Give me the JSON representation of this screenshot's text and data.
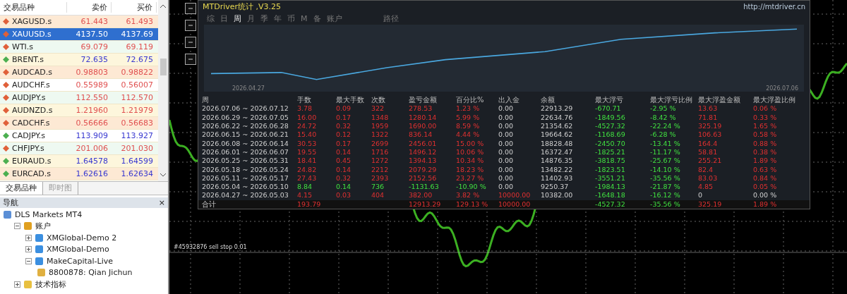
{
  "market_watch": {
    "columns": [
      "交易品种",
      "卖价",
      "买价"
    ],
    "rows": [
      {
        "symbol": "XAGUSD.s",
        "bid": "61.443",
        "ask": "61.493",
        "rising": false,
        "selected": false
      },
      {
        "symbol": "XAUUSD.s",
        "bid": "4137.50",
        "ask": "4137.69",
        "rising": false,
        "selected": true
      },
      {
        "symbol": "WTI.s",
        "bid": "69.079",
        "ask": "69.119",
        "rising": false,
        "selected": false
      },
      {
        "symbol": "BRENT.s",
        "bid": "72.635",
        "ask": "72.675",
        "rising": true,
        "selected": false
      },
      {
        "symbol": "AUDCAD.s",
        "bid": "0.98803",
        "ask": "0.98822",
        "rising": false,
        "selected": false
      },
      {
        "symbol": "AUDCHF.s",
        "bid": "0.55989",
        "ask": "0.56007",
        "rising": false,
        "selected": false
      },
      {
        "symbol": "AUDJPY.s",
        "bid": "112.550",
        "ask": "112.570",
        "rising": false,
        "selected": false
      },
      {
        "symbol": "AUDNZD.s",
        "bid": "1.21960",
        "ask": "1.21979",
        "rising": false,
        "selected": false
      },
      {
        "symbol": "CADCHF.s",
        "bid": "0.56666",
        "ask": "0.56683",
        "rising": false,
        "selected": false
      },
      {
        "symbol": "CADJPY.s",
        "bid": "113.909",
        "ask": "113.927",
        "rising": true,
        "selected": false
      },
      {
        "symbol": "CHFJPY.s",
        "bid": "201.006",
        "ask": "201.030",
        "rising": false,
        "selected": false
      },
      {
        "symbol": "EURAUD.s",
        "bid": "1.64578",
        "ask": "1.64599",
        "rising": true,
        "selected": false
      },
      {
        "symbol": "EURCAD.s",
        "bid": "1.62616",
        "ask": "1.62634",
        "rising": true,
        "selected": false
      }
    ],
    "tabs": [
      {
        "label": "交易品种",
        "selected": true
      },
      {
        "label": "即时图",
        "selected": false
      }
    ]
  },
  "navigator": {
    "title": "导航",
    "close": "×",
    "tree": [
      {
        "label": "DLS Markets MT4",
        "kind": "terminal",
        "children": [
          {
            "label": "账户",
            "kind": "accounts",
            "expanded": true,
            "children": [
              {
                "label": "XMGlobal-Demo 2",
                "kind": "server",
                "expanded": false
              },
              {
                "label": "XMGlobal-Demo",
                "kind": "server",
                "expanded": false
              },
              {
                "label": "MakeCapital-Live",
                "kind": "server",
                "expanded": true,
                "children": [
                  {
                    "label": "8800878: Qian Jichun",
                    "kind": "account"
                  }
                ]
              }
            ]
          },
          {
            "label": "技术指标",
            "kind": "indicators",
            "expanded": false
          }
        ]
      }
    ]
  },
  "chart": {
    "order_label": "#45932876 sell stop 0.01"
  },
  "stats_panel": {
    "title": "MTDriver统计 ,V3.25",
    "link": "http://mtdriver.cn",
    "tabs": [
      {
        "label": "综",
        "selected": false
      },
      {
        "label": "日",
        "selected": false
      },
      {
        "label": "周",
        "selected": true
      },
      {
        "label": "月",
        "selected": false
      },
      {
        "label": "季",
        "selected": false
      },
      {
        "label": "年",
        "selected": false
      },
      {
        "label": "币",
        "selected": false
      },
      {
        "label": "M",
        "selected": false
      },
      {
        "label": "备",
        "selected": false
      },
      {
        "label": "账户",
        "selected": false
      },
      {
        "label": "路径",
        "selected": false
      }
    ],
    "equity_dates": [
      "2026.04.27",
      "2026.07.06"
    ],
    "columns": [
      "周",
      "手数",
      "最大手数",
      "次数",
      "盈亏金额",
      "百分比%",
      "出入金",
      "余额",
      "最大浮亏",
      "最大浮亏比例",
      "最大浮盈金额",
      "最大浮盈比例"
    ],
    "rows": [
      {
        "loss": false,
        "deposit": false,
        "float_profit": true,
        "cells": [
          "2026.07.06 ~ 2026.07.12",
          "3.78",
          "0.09",
          "322",
          "278.53",
          "1.23 %",
          "0.00",
          "22913.29",
          "-670.71",
          "-2.95 %",
          "13.63",
          "0.06 %"
        ]
      },
      {
        "loss": false,
        "deposit": false,
        "float_profit": true,
        "cells": [
          "2026.06.29 ~ 2026.07.05",
          "16.00",
          "0.17",
          "1348",
          "1280.14",
          "5.99 %",
          "0.00",
          "22634.76",
          "-1849.56",
          "-8.42 %",
          "71.81",
          "0.33 %"
        ]
      },
      {
        "loss": false,
        "deposit": false,
        "float_profit": true,
        "cells": [
          "2026.06.22 ~ 2026.06.28",
          "24.72",
          "0.32",
          "1959",
          "1690.00",
          "8.59 %",
          "0.00",
          "21354.62",
          "-4527.32",
          "-22.24 %",
          "325.19",
          "1.65 %"
        ]
      },
      {
        "loss": false,
        "deposit": false,
        "float_profit": true,
        "cells": [
          "2026.06.15 ~ 2026.06.21",
          "15.40",
          "0.12",
          "1322",
          "836.14",
          "4.44 %",
          "0.00",
          "19664.62",
          "-1168.69",
          "-6.28 %",
          "106.63",
          "0.58 %"
        ]
      },
      {
        "loss": false,
        "deposit": false,
        "float_profit": true,
        "cells": [
          "2026.06.08 ~ 2026.06.14",
          "30.53",
          "0.17",
          "2699",
          "2456.01",
          "15.00 %",
          "0.00",
          "18828.48",
          "-2450.70",
          "-13.41 %",
          "164.4",
          "0.88 %"
        ]
      },
      {
        "loss": false,
        "deposit": false,
        "float_profit": true,
        "cells": [
          "2026.06.01 ~ 2026.06.07",
          "19.55",
          "0.14",
          "1716",
          "1496.12",
          "10.06 %",
          "0.00",
          "16372.47",
          "-1825.21",
          "-11.17 %",
          "58.81",
          "0.38 %"
        ]
      },
      {
        "loss": false,
        "deposit": false,
        "float_profit": true,
        "cells": [
          "2026.05.25 ~ 2026.05.31",
          "18.41",
          "0.45",
          "1272",
          "1394.13",
          "10.34 %",
          "0.00",
          "14876.35",
          "-3818.75",
          "-25.67 %",
          "255.21",
          "1.89 %"
        ]
      },
      {
        "loss": false,
        "deposit": false,
        "float_profit": true,
        "cells": [
          "2026.05.18 ~ 2026.05.24",
          "24.82",
          "0.14",
          "2212",
          "2079.29",
          "18.23 %",
          "0.00",
          "13482.22",
          "-1823.51",
          "-14.10 %",
          "82.4",
          "0.63 %"
        ]
      },
      {
        "loss": false,
        "deposit": false,
        "float_profit": true,
        "cells": [
          "2026.05.11 ~ 2026.05.17",
          "27.43",
          "0.32",
          "2393",
          "2152.56",
          "23.27 %",
          "0.00",
          "11402.93",
          "-3551.21",
          "-35.56 %",
          "83.03",
          "0.84 %"
        ]
      },
      {
        "loss": true,
        "deposit": false,
        "float_profit": true,
        "cells": [
          "2026.05.04 ~ 2026.05.10",
          "8.84",
          "0.14",
          "736",
          "-1131.63",
          "-10.90 %",
          "0.00",
          "9250.37",
          "-1984.13",
          "-21.87 %",
          "4.85",
          "0.05 %"
        ]
      },
      {
        "loss": false,
        "deposit": true,
        "float_profit": false,
        "cells": [
          "2026.04.27 ~ 2026.05.03",
          "4.15",
          "0.03",
          "404",
          "382.00",
          "3.82 %",
          "10000.00",
          "10382.00",
          "-1648.18",
          "-16.12 %",
          "0",
          "0.00 %"
        ]
      }
    ],
    "total": {
      "loss": false,
      "deposit": true,
      "float_profit": true,
      "cells": [
        "合计",
        "193.79",
        null,
        null,
        "12913.29",
        "129.13 %",
        "10000.00",
        null,
        "-4527.32",
        "-35.56 %",
        "325.19",
        "1.89 %"
      ]
    }
  }
}
